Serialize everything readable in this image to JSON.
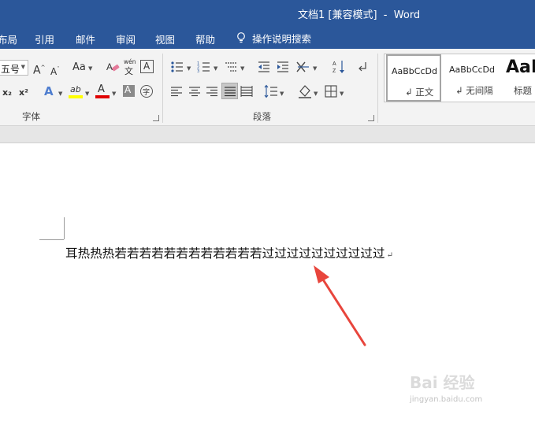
{
  "window": {
    "title": "文档1 [兼容模式]  -  Word"
  },
  "tabs": [
    {
      "label": "布局"
    },
    {
      "label": "引用"
    },
    {
      "label": "邮件"
    },
    {
      "label": "审阅"
    },
    {
      "label": "视图"
    },
    {
      "label": "帮助"
    }
  ],
  "tell_me": {
    "label": "操作说明搜索"
  },
  "font_group": {
    "label": "字体",
    "size_value": "五号",
    "case_label": "Aa",
    "phonetic_label": "wén",
    "phonetic_char": "文",
    "border_char_label": "A",
    "enclose_label": "字",
    "subscript": "x₂",
    "superscript": "x²",
    "effects_label": "A",
    "font_color_label": "A",
    "highlight_label": "ab",
    "shading_label": "A"
  },
  "paragraph_group": {
    "label": "段落"
  },
  "styles": [
    {
      "sample": "AaBbCcDd",
      "name": "正文",
      "selected": true
    },
    {
      "sample": "AaBbCcDd",
      "name": "无间隔",
      "selected": false
    },
    {
      "sample": "AaB",
      "name": "标题",
      "selected": false
    }
  ],
  "document": {
    "text": "耳热热热若若若若若若若若若若若若过过过过过过过过过过",
    "paragraph_mark": "↵"
  },
  "watermark": {
    "main": "Bai 经验",
    "sub": "jingyan.baidu.com"
  },
  "colors": {
    "titlebar": "#2b579a",
    "ribbon": "#f3f3f3",
    "arrow": "#e8453c",
    "font_color_bar": "#e00000",
    "highlight_bar": "#ffff00"
  }
}
